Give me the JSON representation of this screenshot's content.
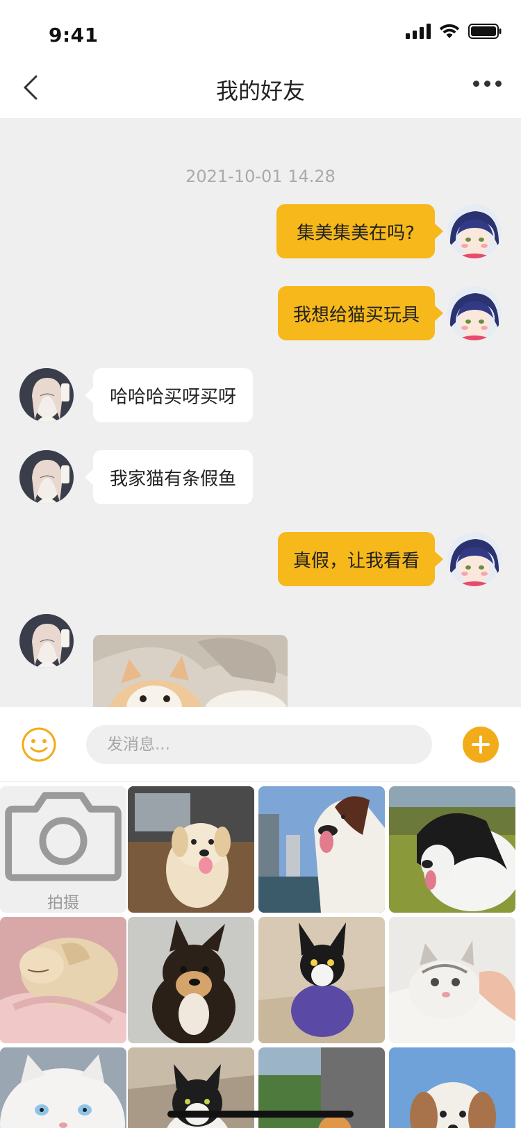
{
  "status_bar": {
    "time": "9:41"
  },
  "nav": {
    "title": "我的好友"
  },
  "chat": {
    "timestamp": "2021-10-01 14.28",
    "messages": [
      {
        "side": "right",
        "text": "集美集美在吗?"
      },
      {
        "side": "right",
        "text": "我想给猫买玩具"
      },
      {
        "side": "left",
        "text": "哈哈哈买呀买呀"
      },
      {
        "side": "left",
        "text": "我家猫有条假鱼"
      },
      {
        "side": "right",
        "text": "真假，让我看看"
      }
    ]
  },
  "input_bar": {
    "placeholder": "发消息..."
  },
  "photo_grid": {
    "camera_label": "拍摄"
  },
  "colors": {
    "accent": "#f6b81a",
    "chat_bg": "#efefef",
    "plus_button": "#f2ac1a"
  }
}
